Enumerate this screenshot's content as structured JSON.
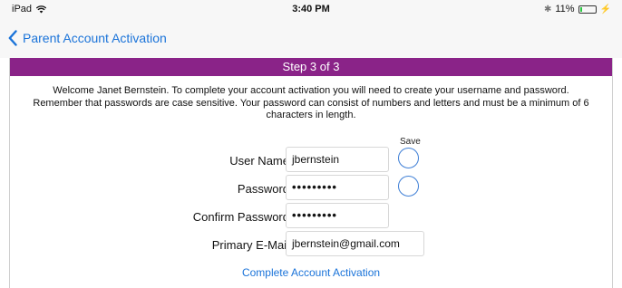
{
  "status_bar": {
    "device": "iPad",
    "time": "3:40 PM",
    "battery_percent": "11%"
  },
  "nav": {
    "back_label": "Parent Account Activation"
  },
  "step": {
    "label": "Step 3 of 3"
  },
  "welcome_text": [
    "Welcome Janet Bernstein. To complete your account activation you will need to create your username and password.",
    "Remember that passwords are case sensitive. Your password can consist of numbers and letters and must be a minimum of 6",
    "characters in length."
  ],
  "form": {
    "save_label": "Save",
    "username_label": "User Name",
    "username_value": "jbernstein",
    "password_label": "Password",
    "password_value": "•••••••••",
    "confirm_label": "Confirm Password",
    "confirm_value": "•••••••••",
    "email_label": "Primary E-Mail",
    "email_value": "jbernstein@gmail.com"
  },
  "actions": {
    "complete_label": "Complete Account Activation"
  },
  "colors": {
    "step_bar": "#8a2388",
    "link": "#1a73d9"
  }
}
